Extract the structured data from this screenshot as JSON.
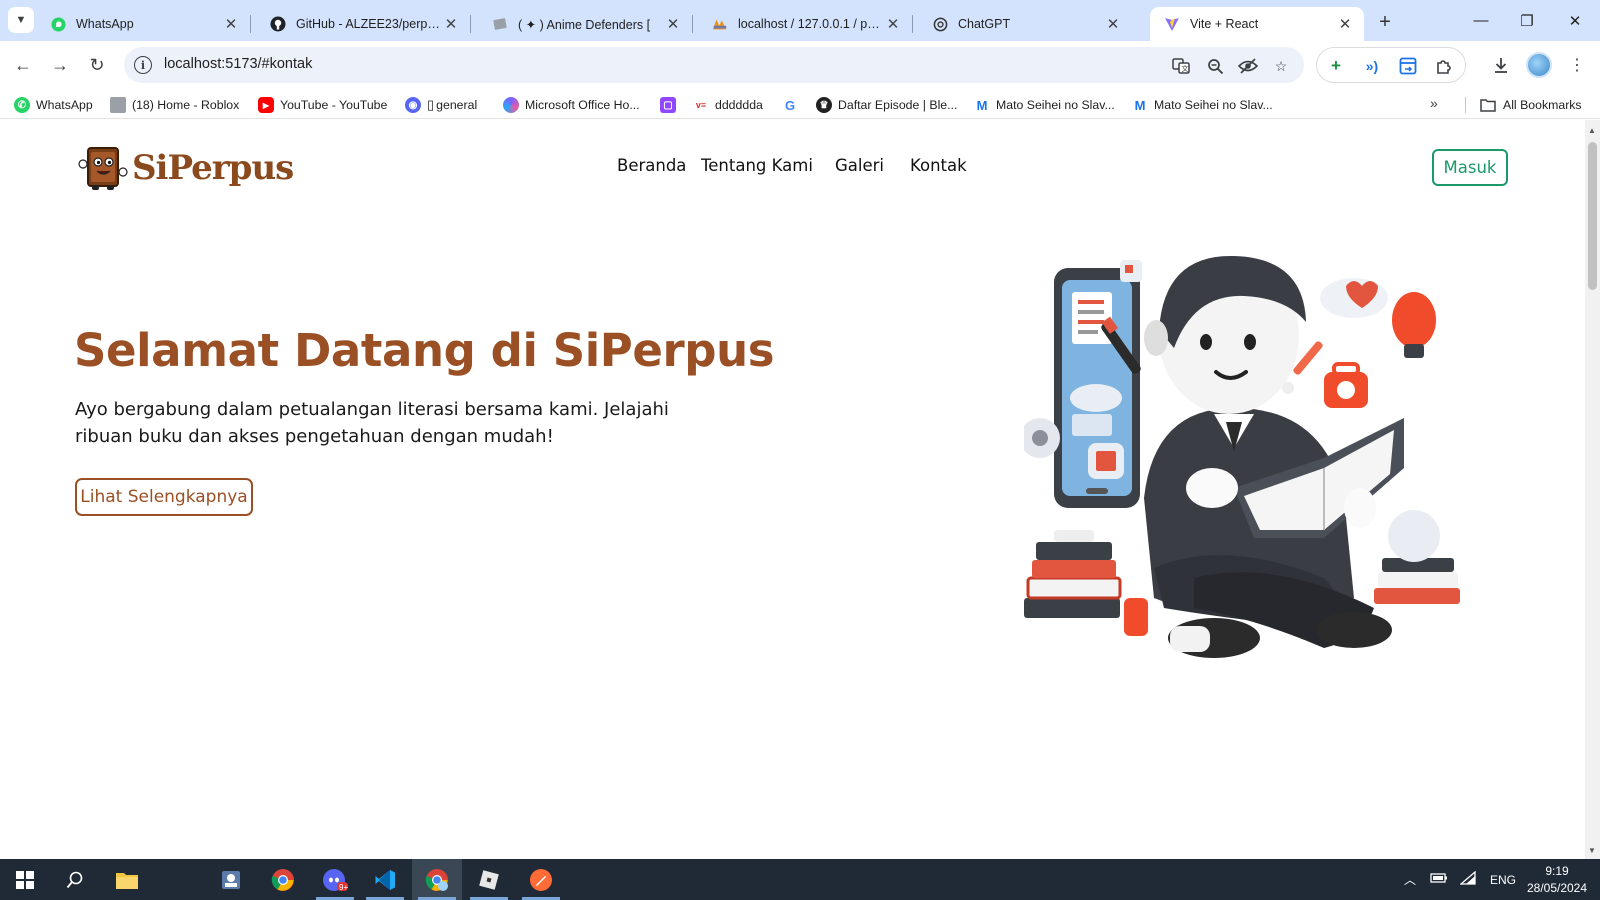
{
  "browser": {
    "tabs": [
      {
        "title": "WhatsApp",
        "icon": "whatsapp-icon",
        "active": false
      },
      {
        "title": "GitHub - ALZEE23/perpus-",
        "icon": "github-icon",
        "active": false
      },
      {
        "title": "( ✦ ) Anime Defenders [",
        "icon": "roblox-game-icon",
        "active": false
      },
      {
        "title": "localhost / 127.0.0.1 / perp",
        "icon": "phpmyadmin-icon",
        "active": false
      },
      {
        "title": "ChatGPT",
        "icon": "chatgpt-icon",
        "active": false
      },
      {
        "title": "Vite + React",
        "icon": "vite-icon",
        "active": true
      }
    ],
    "url": "localhost:5173/#kontak",
    "bookmarks": [
      {
        "label": "WhatsApp",
        "icon": "whatsapp-icon",
        "color": "#25d366"
      },
      {
        "label": "(18) Home - Roblox",
        "icon": "roblox-icon",
        "color": "#9aa0a6"
      },
      {
        "label": "YouTube - YouTube",
        "icon": "youtube-icon",
        "color": "#ff0000"
      },
      {
        "label": "general",
        "icon": "discord-icon",
        "color": "#5865f2"
      },
      {
        "label": "Microsoft Office Ho...",
        "icon": "office-icon",
        "color": "#7b61ff"
      },
      {
        "label": "",
        "icon": "twitch-icon",
        "color": "#9146ff"
      },
      {
        "label": "dddddda",
        "icon": "vercel-icon",
        "color": "#d93025"
      },
      {
        "label": "",
        "icon": "google-icon",
        "color": "#4285f4"
      },
      {
        "label": "Daftar Episode | Ble...",
        "icon": "anime-site-icon",
        "color": "#222222"
      },
      {
        "label": "Mato Seihei no Slav...",
        "icon": "manga-site-icon",
        "color": "#1a73e8"
      },
      {
        "label": "Mato Seihei no Slav...",
        "icon": "manga-site-icon",
        "color": "#1a73e8"
      }
    ],
    "all_bookmarks": "All Bookmarks"
  },
  "site": {
    "brand": "SiPerpus",
    "nav": [
      "Beranda",
      "Tentang Kami",
      "Galeri",
      "Kontak"
    ],
    "login_button": "Masuk",
    "hero": {
      "title": "Selamat Datang di SiPerpus",
      "text": "Ayo bergabung dalam petualangan literasi bersama kami. Jelajahi ribuan buku dan akses pengetahuan dengan mudah!",
      "cta": "Lihat Selengkapnya"
    },
    "colors": {
      "brand": "#9a4f24",
      "login": "#1a9a6a"
    }
  },
  "taskbar": {
    "lang": "ENG",
    "time": "9:19",
    "date": "28/05/2024",
    "discord_badge": "9+"
  }
}
